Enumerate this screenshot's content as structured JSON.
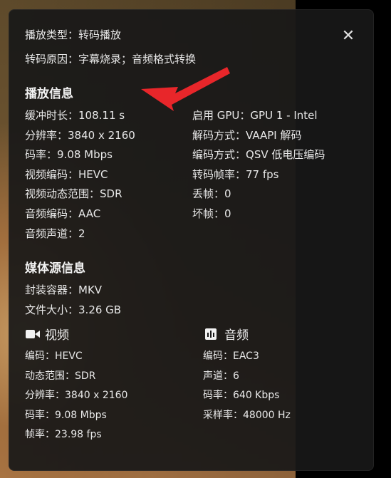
{
  "header": {
    "play_type_label": "播放类型：",
    "play_type_value": "转码播放",
    "transcode_reason_label": "转码原因：",
    "transcode_reason_value": "字幕烧录；音频格式转换"
  },
  "playback_info": {
    "title": "播放信息",
    "left": [
      {
        "label": "缓冲时长：",
        "value": "108.11 s"
      },
      {
        "label": "分辨率：",
        "value": "3840 x 2160"
      },
      {
        "label": "码率：",
        "value": "9.08 Mbps"
      },
      {
        "label": "视频编码：",
        "value": "HEVC"
      },
      {
        "label": "视频动态范围：",
        "value": "SDR"
      },
      {
        "label": "音频编码：",
        "value": "AAC"
      },
      {
        "label": "音频声道：",
        "value": "2"
      }
    ],
    "right": [
      {
        "label": "启用 GPU：",
        "value": "GPU 1 - Intel"
      },
      {
        "label": "解码方式：",
        "value": "VAAPI 解码"
      },
      {
        "label": "编码方式：",
        "value": "QSV 低电压编码"
      },
      {
        "label": "转码帧率：",
        "value": "77 fps"
      },
      {
        "label": "丢帧：",
        "value": "0"
      },
      {
        "label": "坏帧：",
        "value": "0"
      }
    ]
  },
  "media_source": {
    "title": "媒体源信息",
    "container_label": "封装容器：",
    "container_value": "MKV",
    "file_size_label": "文件大小：",
    "file_size_value": "3.26 GB",
    "video": {
      "title": "视频",
      "icon": "video-camera-icon",
      "rows": [
        {
          "label": "编码：",
          "value": "HEVC"
        },
        {
          "label": "动态范围：",
          "value": "SDR"
        },
        {
          "label": "分辨率：",
          "value": "3840 x 2160"
        },
        {
          "label": "码率：",
          "value": "9.08 Mbps"
        },
        {
          "label": "帧率：",
          "value": "23.98 fps"
        }
      ]
    },
    "audio": {
      "title": "音频",
      "icon": "audio-bars-icon",
      "rows": [
        {
          "label": "编码：",
          "value": "EAC3"
        },
        {
          "label": "声道：",
          "value": "6"
        },
        {
          "label": "码率：",
          "value": "640 Kbps"
        },
        {
          "label": "采样率：",
          "value": "48000 Hz"
        }
      ]
    }
  },
  "annotation": {
    "arrow_color": "#e8262a"
  },
  "close_icon": "close-icon"
}
